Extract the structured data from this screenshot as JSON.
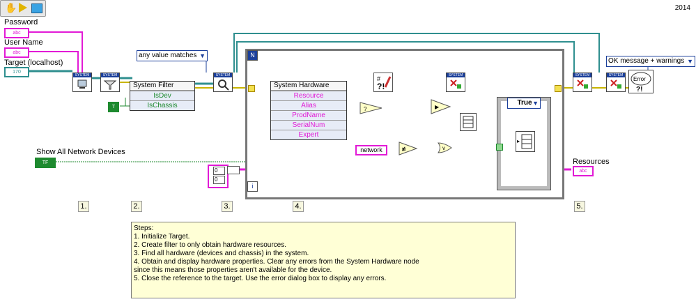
{
  "header": {
    "year": "2014"
  },
  "controls": {
    "password": "Password",
    "user_name": "User Name",
    "target": "Target (localhost)",
    "show_all": "Show All Network Devices",
    "resources": "Resources"
  },
  "badges": {
    "abc": "abc",
    "path": "170",
    "tf": "TF",
    "t": "T",
    "system": "SYSTEM",
    "zero": "0"
  },
  "rings": {
    "match_mode": "any value matches",
    "error_mode": "OK message + warnings"
  },
  "filter_node": {
    "title": "System Filter",
    "rows": [
      "IsDev",
      "IsChassis"
    ]
  },
  "hardware_node": {
    "title": "System Hardware",
    "rows": [
      "Resource",
      "Alias",
      "ProdName",
      "SerialNum",
      "Expert"
    ]
  },
  "case": {
    "label": "True"
  },
  "string_const": "network",
  "loop": {
    "n": "N",
    "i": "i"
  },
  "steps": [
    "1.",
    "2.",
    "3.",
    "4.",
    "5."
  ],
  "notes": {
    "title": "Steps:",
    "lines": [
      "1. Initialize Target.",
      "2. Create filter to only obtain hardware resources.",
      "3. Find all hardware (devices and chassis) in the system.",
      "4. Obtain and display hardware properties. Clear any errors from the System Hardware node",
      "since this means those properties aren't available for the device.",
      "5. Close the reference to the target. Use the error dialog box to display any errors."
    ]
  },
  "colors": {
    "string_wire": "#e21ad6",
    "bool_wire": "#1e8a2f",
    "ref_wire": "#2f8f8f",
    "error_wire": "#c8b400"
  }
}
